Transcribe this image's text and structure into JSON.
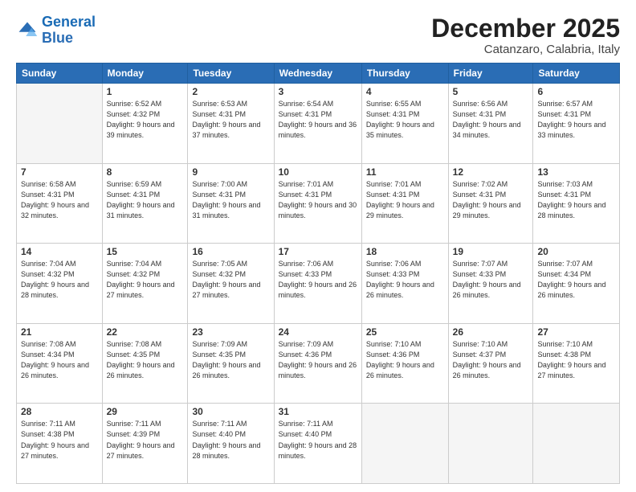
{
  "logo": {
    "line1": "General",
    "line2": "Blue"
  },
  "header": {
    "month": "December 2025",
    "location": "Catanzaro, Calabria, Italy"
  },
  "weekdays": [
    "Sunday",
    "Monday",
    "Tuesday",
    "Wednesday",
    "Thursday",
    "Friday",
    "Saturday"
  ],
  "weeks": [
    [
      {
        "day": "",
        "sunrise": "",
        "sunset": "",
        "daylight": ""
      },
      {
        "day": "1",
        "sunrise": "Sunrise: 6:52 AM",
        "sunset": "Sunset: 4:32 PM",
        "daylight": "Daylight: 9 hours and 39 minutes."
      },
      {
        "day": "2",
        "sunrise": "Sunrise: 6:53 AM",
        "sunset": "Sunset: 4:31 PM",
        "daylight": "Daylight: 9 hours and 37 minutes."
      },
      {
        "day": "3",
        "sunrise": "Sunrise: 6:54 AM",
        "sunset": "Sunset: 4:31 PM",
        "daylight": "Daylight: 9 hours and 36 minutes."
      },
      {
        "day": "4",
        "sunrise": "Sunrise: 6:55 AM",
        "sunset": "Sunset: 4:31 PM",
        "daylight": "Daylight: 9 hours and 35 minutes."
      },
      {
        "day": "5",
        "sunrise": "Sunrise: 6:56 AM",
        "sunset": "Sunset: 4:31 PM",
        "daylight": "Daylight: 9 hours and 34 minutes."
      },
      {
        "day": "6",
        "sunrise": "Sunrise: 6:57 AM",
        "sunset": "Sunset: 4:31 PM",
        "daylight": "Daylight: 9 hours and 33 minutes."
      }
    ],
    [
      {
        "day": "7",
        "sunrise": "Sunrise: 6:58 AM",
        "sunset": "Sunset: 4:31 PM",
        "daylight": "Daylight: 9 hours and 32 minutes."
      },
      {
        "day": "8",
        "sunrise": "Sunrise: 6:59 AM",
        "sunset": "Sunset: 4:31 PM",
        "daylight": "Daylight: 9 hours and 31 minutes."
      },
      {
        "day": "9",
        "sunrise": "Sunrise: 7:00 AM",
        "sunset": "Sunset: 4:31 PM",
        "daylight": "Daylight: 9 hours and 31 minutes."
      },
      {
        "day": "10",
        "sunrise": "Sunrise: 7:01 AM",
        "sunset": "Sunset: 4:31 PM",
        "daylight": "Daylight: 9 hours and 30 minutes."
      },
      {
        "day": "11",
        "sunrise": "Sunrise: 7:01 AM",
        "sunset": "Sunset: 4:31 PM",
        "daylight": "Daylight: 9 hours and 29 minutes."
      },
      {
        "day": "12",
        "sunrise": "Sunrise: 7:02 AM",
        "sunset": "Sunset: 4:31 PM",
        "daylight": "Daylight: 9 hours and 29 minutes."
      },
      {
        "day": "13",
        "sunrise": "Sunrise: 7:03 AM",
        "sunset": "Sunset: 4:31 PM",
        "daylight": "Daylight: 9 hours and 28 minutes."
      }
    ],
    [
      {
        "day": "14",
        "sunrise": "Sunrise: 7:04 AM",
        "sunset": "Sunset: 4:32 PM",
        "daylight": "Daylight: 9 hours and 28 minutes."
      },
      {
        "day": "15",
        "sunrise": "Sunrise: 7:04 AM",
        "sunset": "Sunset: 4:32 PM",
        "daylight": "Daylight: 9 hours and 27 minutes."
      },
      {
        "day": "16",
        "sunrise": "Sunrise: 7:05 AM",
        "sunset": "Sunset: 4:32 PM",
        "daylight": "Daylight: 9 hours and 27 minutes."
      },
      {
        "day": "17",
        "sunrise": "Sunrise: 7:06 AM",
        "sunset": "Sunset: 4:33 PM",
        "daylight": "Daylight: 9 hours and 26 minutes."
      },
      {
        "day": "18",
        "sunrise": "Sunrise: 7:06 AM",
        "sunset": "Sunset: 4:33 PM",
        "daylight": "Daylight: 9 hours and 26 minutes."
      },
      {
        "day": "19",
        "sunrise": "Sunrise: 7:07 AM",
        "sunset": "Sunset: 4:33 PM",
        "daylight": "Daylight: 9 hours and 26 minutes."
      },
      {
        "day": "20",
        "sunrise": "Sunrise: 7:07 AM",
        "sunset": "Sunset: 4:34 PM",
        "daylight": "Daylight: 9 hours and 26 minutes."
      }
    ],
    [
      {
        "day": "21",
        "sunrise": "Sunrise: 7:08 AM",
        "sunset": "Sunset: 4:34 PM",
        "daylight": "Daylight: 9 hours and 26 minutes."
      },
      {
        "day": "22",
        "sunrise": "Sunrise: 7:08 AM",
        "sunset": "Sunset: 4:35 PM",
        "daylight": "Daylight: 9 hours and 26 minutes."
      },
      {
        "day": "23",
        "sunrise": "Sunrise: 7:09 AM",
        "sunset": "Sunset: 4:35 PM",
        "daylight": "Daylight: 9 hours and 26 minutes."
      },
      {
        "day": "24",
        "sunrise": "Sunrise: 7:09 AM",
        "sunset": "Sunset: 4:36 PM",
        "daylight": "Daylight: 9 hours and 26 minutes."
      },
      {
        "day": "25",
        "sunrise": "Sunrise: 7:10 AM",
        "sunset": "Sunset: 4:36 PM",
        "daylight": "Daylight: 9 hours and 26 minutes."
      },
      {
        "day": "26",
        "sunrise": "Sunrise: 7:10 AM",
        "sunset": "Sunset: 4:37 PM",
        "daylight": "Daylight: 9 hours and 26 minutes."
      },
      {
        "day": "27",
        "sunrise": "Sunrise: 7:10 AM",
        "sunset": "Sunset: 4:38 PM",
        "daylight": "Daylight: 9 hours and 27 minutes."
      }
    ],
    [
      {
        "day": "28",
        "sunrise": "Sunrise: 7:11 AM",
        "sunset": "Sunset: 4:38 PM",
        "daylight": "Daylight: 9 hours and 27 minutes."
      },
      {
        "day": "29",
        "sunrise": "Sunrise: 7:11 AM",
        "sunset": "Sunset: 4:39 PM",
        "daylight": "Daylight: 9 hours and 27 minutes."
      },
      {
        "day": "30",
        "sunrise": "Sunrise: 7:11 AM",
        "sunset": "Sunset: 4:40 PM",
        "daylight": "Daylight: 9 hours and 28 minutes."
      },
      {
        "day": "31",
        "sunrise": "Sunrise: 7:11 AM",
        "sunset": "Sunset: 4:40 PM",
        "daylight": "Daylight: 9 hours and 28 minutes."
      },
      {
        "day": "",
        "sunrise": "",
        "sunset": "",
        "daylight": ""
      },
      {
        "day": "",
        "sunrise": "",
        "sunset": "",
        "daylight": ""
      },
      {
        "day": "",
        "sunrise": "",
        "sunset": "",
        "daylight": ""
      }
    ]
  ]
}
